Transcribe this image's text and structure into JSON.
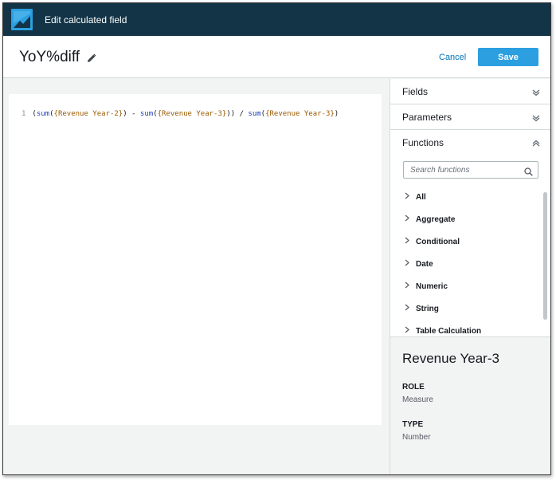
{
  "topbar": {
    "title": "Edit calculated field"
  },
  "header": {
    "field_name": "YoY%diff",
    "cancel_label": "Cancel",
    "save_label": "Save"
  },
  "editor": {
    "line_number": "1",
    "tokens": {
      "t1": "(",
      "t2": "sum",
      "t3": "(",
      "t4": "{Revenue Year-2}",
      "t5": ") - ",
      "t6": "sum",
      "t7": "(",
      "t8": "{Revenue Year-3}",
      "t9": ")) / ",
      "t10": "sum",
      "t11": "(",
      "t12": "{Revenue Year-3}",
      "t13": ")"
    }
  },
  "sidebar": {
    "fields_label": "Fields",
    "parameters_label": "Parameters",
    "functions_label": "Functions",
    "search_placeholder": "Search functions",
    "function_categories": [
      "All",
      "Aggregate",
      "Conditional",
      "Date",
      "Numeric",
      "String",
      "Table Calculation"
    ]
  },
  "details": {
    "title": "Revenue Year-3",
    "role_label": "ROLE",
    "role_value": "Measure",
    "type_label": "TYPE",
    "type_value": "Number"
  },
  "colors": {
    "topbar_bg": "#123446",
    "accent": "#2b9fe0",
    "link": "#0073bb",
    "function_token": "#1a3fb8",
    "field_token": "#9a5a00"
  },
  "icons": {
    "logo": "quicksight-logo-icon",
    "edit": "pencil-icon",
    "collapse": "chevron-down-icon",
    "expand": "chevron-up-icon",
    "search": "search-icon",
    "category": "chevron-right-icon"
  }
}
